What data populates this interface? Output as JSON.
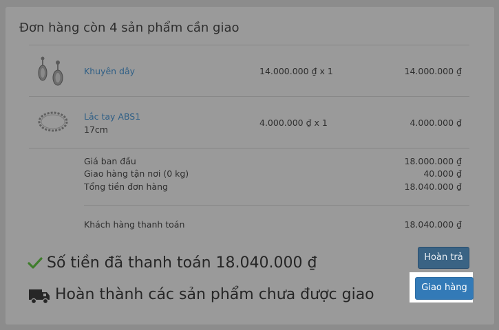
{
  "order": {
    "title": "Đơn hàng còn 4 sản phẩm cần giao",
    "items": [
      {
        "name": "Khuyên dây",
        "variant": "",
        "price_qty": "14.000.000 ₫ x 1",
        "total": "14.000.000 ₫",
        "icon": "earring-icon"
      },
      {
        "name": "Lắc tay ABS1",
        "variant": "17cm",
        "price_qty": "4.000.000 ₫ x 1",
        "total": "4.000.000 ₫",
        "icon": "bracelet-icon"
      }
    ],
    "summary": {
      "subtotal_label": "Giá ban đầu",
      "subtotal_value": "18.000.000 ₫",
      "shipping_label": "Giao hàng tận nơi (0 kg)",
      "shipping_value": "40.000 ₫",
      "total_label": "Tổng tiền đơn hàng",
      "total_value": "18.040.000 ₫",
      "paid_label": "Khách hàng thanh toán",
      "paid_value": "18.040.000 ₫"
    },
    "status": {
      "paid_text": "Số tiền đã thanh toán 18.040.000 ₫",
      "paid_icon": "check-icon",
      "fulfill_text": "Hoàn thành các sản phẩm chưa được giao",
      "fulfill_icon": "truck-icon"
    },
    "actions": {
      "refund_label": "Hoàn trả",
      "ship_label": "Giao hàng"
    },
    "colors": {
      "check": "#3f7d2c",
      "primary_button": "#337ab7",
      "link": "#2f5f86"
    }
  }
}
